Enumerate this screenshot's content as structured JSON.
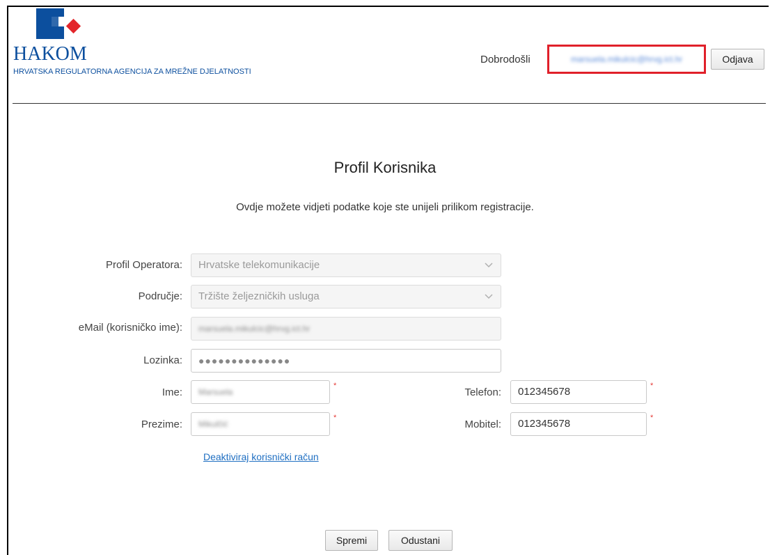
{
  "header": {
    "logo_word": "HAKOM",
    "logo_subtitle": "HRVATSKA REGULATORNA AGENCIJA ZA MREŽNE DJELATNOSTI",
    "welcome": "Dobrodošli",
    "user_email": "marsuela.mikulcic@hrvg.ict.hr",
    "logout_label": "Odjava"
  },
  "page": {
    "title": "Profil Korisnika",
    "description": "Ovdje možete vidjeti podatke koje ste unijeli prilikom registracije."
  },
  "form": {
    "operator_profile": {
      "label": "Profil Operatora:",
      "value": "Hrvatske telekomunikacije"
    },
    "area": {
      "label": "Područje:",
      "value": "Tržište željezničkih usluga"
    },
    "email": {
      "label": "eMail (korisničko ime):",
      "value": "marsuela.mikulcic@hrvg.ict.hr"
    },
    "password": {
      "label": "Lozinka:",
      "value": "●●●●●●●●●●●●●●"
    },
    "first_name": {
      "label": "Ime:",
      "value": "Marsuela"
    },
    "last_name": {
      "label": "Prezime:",
      "value": "Mikulčić"
    },
    "phone": {
      "label": "Telefon:",
      "value": "012345678"
    },
    "mobile": {
      "label": "Mobitel:",
      "value": "012345678"
    },
    "required_mark": "*"
  },
  "deactivate_link": "Deaktiviraj korisnički račun",
  "actions": {
    "save_label": "Spremi",
    "cancel_label": "Odustani"
  },
  "colors": {
    "brand_blue": "#0c4f9e",
    "brand_red": "#e3262b",
    "highlight_red": "#e0202a",
    "link_blue": "#1f6fc2"
  }
}
